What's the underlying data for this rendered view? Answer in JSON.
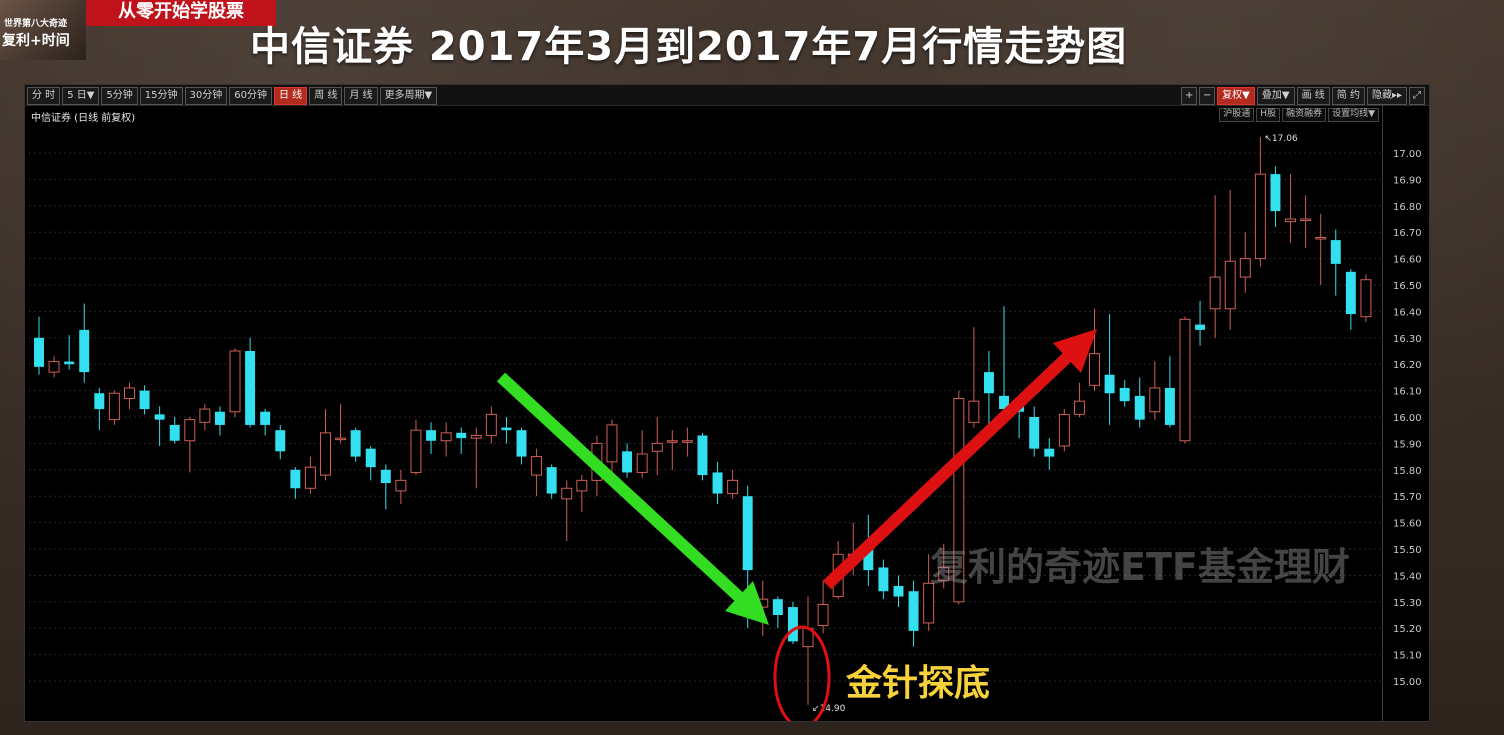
{
  "header": {
    "title": "中信证券 2017年3月到2017年7月行情走势图",
    "brand_banner": "从零开始学股票",
    "avatar_line1": "世界第八大奇迹",
    "avatar_line2": "复利+时间"
  },
  "toolbar": {
    "periods": [
      "分 时",
      "5 日▼",
      "5分钟",
      "15分钟",
      "30分钟",
      "60分钟",
      "日 线",
      "周 线",
      "月 线",
      "更多周期▼"
    ],
    "active_period": "日 线",
    "right_buttons": [
      "+",
      "−",
      "复权▼",
      "叠加▼",
      "画 线",
      "简 约",
      "隐藏▸▸",
      "⤢"
    ],
    "active_right": "复权▼"
  },
  "chart_header": {
    "label": "中信证券 (日线 前复权)",
    "sub_tabs": [
      "沪股通",
      "H股",
      "融资融券",
      "设置均线▼"
    ]
  },
  "annotations": {
    "pattern_label": "金针探底",
    "watermark": "复利的奇迹ETF基金理财",
    "high_label": "17.06",
    "low_label": "14.90"
  },
  "colors": {
    "up": "#ff4d4d",
    "down": "#33e0f0",
    "green_arrow": "#33dd22",
    "red_arrow": "#dd1111",
    "grid": "#262626"
  },
  "chart_data": {
    "type": "candlestick",
    "ylim": [
      14.9,
      17.1
    ],
    "yticks": [
      "17.00",
      "16.90",
      "16.80",
      "16.70",
      "16.60",
      "16.50",
      "16.40",
      "16.30",
      "16.20",
      "16.10",
      "16.00",
      "15.90",
      "15.80",
      "15.70",
      "15.60",
      "15.50",
      "15.40",
      "15.30",
      "15.20",
      "15.10",
      "15.00"
    ],
    "candles": [
      {
        "o": 16.3,
        "c": 16.19,
        "h": 16.38,
        "l": 16.16
      },
      {
        "o": 16.17,
        "c": 16.21,
        "h": 16.23,
        "l": 16.15
      },
      {
        "o": 16.21,
        "c": 16.2,
        "h": 16.31,
        "l": 16.18
      },
      {
        "o": 16.33,
        "c": 16.17,
        "h": 16.43,
        "l": 16.13
      },
      {
        "o": 16.09,
        "c": 16.03,
        "h": 16.11,
        "l": 15.95
      },
      {
        "o": 15.99,
        "c": 16.09,
        "h": 16.1,
        "l": 15.97
      },
      {
        "o": 16.07,
        "c": 16.11,
        "h": 16.13,
        "l": 16.03
      },
      {
        "o": 16.1,
        "c": 16.03,
        "h": 16.12,
        "l": 16.01
      },
      {
        "o": 16.01,
        "c": 15.99,
        "h": 16.04,
        "l": 15.89
      },
      {
        "o": 15.97,
        "c": 15.91,
        "h": 16.0,
        "l": 15.9
      },
      {
        "o": 15.91,
        "c": 15.99,
        "h": 16.0,
        "l": 15.79
      },
      {
        "o": 15.98,
        "c": 16.03,
        "h": 16.05,
        "l": 15.95
      },
      {
        "o": 16.02,
        "c": 15.97,
        "h": 16.04,
        "l": 15.93
      },
      {
        "o": 16.02,
        "c": 16.25,
        "h": 16.26,
        "l": 16.0
      },
      {
        "o": 16.25,
        "c": 15.97,
        "h": 16.3,
        "l": 15.96
      },
      {
        "o": 16.02,
        "c": 15.97,
        "h": 16.03,
        "l": 15.93
      },
      {
        "o": 15.95,
        "c": 15.87,
        "h": 15.97,
        "l": 15.84
      },
      {
        "o": 15.8,
        "c": 15.73,
        "h": 15.81,
        "l": 15.69
      },
      {
        "o": 15.73,
        "c": 15.81,
        "h": 15.85,
        "l": 15.71
      },
      {
        "o": 15.78,
        "c": 15.94,
        "h": 16.03,
        "l": 15.76
      },
      {
        "o": 15.92,
        "c": 15.92,
        "h": 16.05,
        "l": 15.9
      },
      {
        "o": 15.95,
        "c": 15.85,
        "h": 15.96,
        "l": 15.83
      },
      {
        "o": 15.88,
        "c": 15.81,
        "h": 15.89,
        "l": 15.76
      },
      {
        "o": 15.8,
        "c": 15.75,
        "h": 15.82,
        "l": 15.65
      },
      {
        "o": 15.72,
        "c": 15.76,
        "h": 15.8,
        "l": 15.67
      },
      {
        "o": 15.79,
        "c": 15.95,
        "h": 15.99,
        "l": 15.78
      },
      {
        "o": 15.95,
        "c": 15.91,
        "h": 15.98,
        "l": 15.86
      },
      {
        "o": 15.91,
        "c": 15.94,
        "h": 15.98,
        "l": 15.85
      },
      {
        "o": 15.94,
        "c": 15.92,
        "h": 15.96,
        "l": 15.86
      },
      {
        "o": 15.92,
        "c": 15.93,
        "h": 15.96,
        "l": 15.73
      },
      {
        "o": 15.93,
        "c": 16.01,
        "h": 16.04,
        "l": 15.9
      },
      {
        "o": 15.96,
        "c": 15.95,
        "h": 16.0,
        "l": 15.9
      },
      {
        "o": 15.95,
        "c": 15.85,
        "h": 15.96,
        "l": 15.82
      },
      {
        "o": 15.78,
        "c": 15.85,
        "h": 15.88,
        "l": 15.7
      },
      {
        "o": 15.81,
        "c": 15.71,
        "h": 15.82,
        "l": 15.69
      },
      {
        "o": 15.69,
        "c": 15.73,
        "h": 15.76,
        "l": 15.53
      },
      {
        "o": 15.72,
        "c": 15.76,
        "h": 15.78,
        "l": 15.64
      },
      {
        "o": 15.76,
        "c": 15.9,
        "h": 15.93,
        "l": 15.7
      },
      {
        "o": 15.83,
        "c": 15.97,
        "h": 15.99,
        "l": 15.79
      },
      {
        "o": 15.87,
        "c": 15.79,
        "h": 15.9,
        "l": 15.77
      },
      {
        "o": 15.79,
        "c": 15.86,
        "h": 15.95,
        "l": 15.77
      },
      {
        "o": 15.87,
        "c": 15.9,
        "h": 16.0,
        "l": 15.78
      },
      {
        "o": 15.91,
        "c": 15.91,
        "h": 15.95,
        "l": 15.8
      },
      {
        "o": 15.91,
        "c": 15.91,
        "h": 15.96,
        "l": 15.85
      },
      {
        "o": 15.93,
        "c": 15.78,
        "h": 15.94,
        "l": 15.76
      },
      {
        "o": 15.79,
        "c": 15.71,
        "h": 15.83,
        "l": 15.67
      },
      {
        "o": 15.71,
        "c": 15.76,
        "h": 15.8,
        "l": 15.69
      },
      {
        "o": 15.7,
        "c": 15.42,
        "h": 15.74,
        "l": 15.2
      },
      {
        "o": 15.28,
        "c": 15.31,
        "h": 15.38,
        "l": 15.17
      },
      {
        "o": 15.31,
        "c": 15.25,
        "h": 15.32,
        "l": 15.2
      },
      {
        "o": 15.28,
        "c": 15.15,
        "h": 15.3,
        "l": 15.14
      },
      {
        "o": 15.13,
        "c": 15.2,
        "h": 15.32,
        "l": 14.91
      },
      {
        "o": 15.21,
        "c": 15.29,
        "h": 15.38,
        "l": 15.18
      },
      {
        "o": 15.32,
        "c": 15.48,
        "h": 15.53,
        "l": 15.31
      },
      {
        "o": 15.48,
        "c": 15.48,
        "h": 15.6,
        "l": 15.4
      },
      {
        "o": 15.5,
        "c": 15.42,
        "h": 15.63,
        "l": 15.36
      },
      {
        "o": 15.43,
        "c": 15.34,
        "h": 15.46,
        "l": 15.31
      },
      {
        "o": 15.36,
        "c": 15.32,
        "h": 15.4,
        "l": 15.28
      },
      {
        "o": 15.34,
        "c": 15.19,
        "h": 15.38,
        "l": 15.13
      },
      {
        "o": 15.22,
        "c": 15.37,
        "h": 15.48,
        "l": 15.19
      },
      {
        "o": 15.38,
        "c": 15.43,
        "h": 15.52,
        "l": 15.35
      },
      {
        "o": 15.3,
        "c": 16.07,
        "h": 16.1,
        "l": 15.29
      },
      {
        "o": 15.98,
        "c": 16.06,
        "h": 16.34,
        "l": 15.96
      },
      {
        "o": 16.17,
        "c": 16.09,
        "h": 16.25,
        "l": 15.95
      },
      {
        "o": 16.08,
        "c": 16.03,
        "h": 16.42,
        "l": 15.97
      },
      {
        "o": 16.05,
        "c": 16.02,
        "h": 16.08,
        "l": 15.92
      },
      {
        "o": 16.0,
        "c": 15.88,
        "h": 16.04,
        "l": 15.85
      },
      {
        "o": 15.88,
        "c": 15.85,
        "h": 15.92,
        "l": 15.8
      },
      {
        "o": 15.89,
        "c": 16.01,
        "h": 16.03,
        "l": 15.87
      },
      {
        "o": 16.01,
        "c": 16.06,
        "h": 16.13,
        "l": 16.0
      },
      {
        "o": 16.12,
        "c": 16.24,
        "h": 16.41,
        "l": 16.1
      },
      {
        "o": 16.16,
        "c": 16.09,
        "h": 16.39,
        "l": 15.97
      },
      {
        "o": 16.11,
        "c": 16.06,
        "h": 16.14,
        "l": 16.04
      },
      {
        "o": 16.08,
        "c": 15.99,
        "h": 16.15,
        "l": 15.96
      },
      {
        "o": 16.02,
        "c": 16.11,
        "h": 16.21,
        "l": 15.99
      },
      {
        "o": 16.11,
        "c": 15.97,
        "h": 16.23,
        "l": 15.96
      },
      {
        "o": 15.91,
        "c": 16.37,
        "h": 16.38,
        "l": 15.9
      },
      {
        "o": 16.35,
        "c": 16.33,
        "h": 16.44,
        "l": 16.27
      },
      {
        "o": 16.41,
        "c": 16.53,
        "h": 16.84,
        "l": 16.3
      },
      {
        "o": 16.41,
        "c": 16.59,
        "h": 16.86,
        "l": 16.33
      },
      {
        "o": 16.53,
        "c": 16.6,
        "h": 16.7,
        "l": 16.47
      },
      {
        "o": 16.6,
        "c": 16.92,
        "h": 17.06,
        "l": 16.57
      },
      {
        "o": 16.92,
        "c": 16.78,
        "h": 16.95,
        "l": 16.72
      },
      {
        "o": 16.74,
        "c": 16.75,
        "h": 16.92,
        "l": 16.66
      },
      {
        "o": 16.75,
        "c": 16.75,
        "h": 16.84,
        "l": 16.64
      },
      {
        "o": 16.68,
        "c": 16.68,
        "h": 16.77,
        "l": 16.5
      },
      {
        "o": 16.67,
        "c": 16.58,
        "h": 16.71,
        "l": 16.46
      },
      {
        "o": 16.55,
        "c": 16.39,
        "h": 16.56,
        "l": 16.33
      },
      {
        "o": 16.38,
        "c": 16.52,
        "h": 16.54,
        "l": 16.36
      }
    ]
  }
}
